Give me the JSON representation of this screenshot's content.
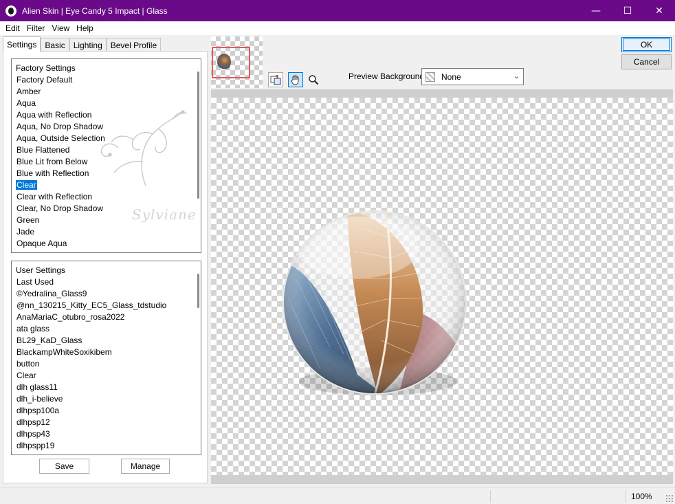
{
  "window": {
    "title": "Alien Skin | Eye Candy 5 Impact | Glass",
    "controls": {
      "minimize": "—",
      "maximize": "☐",
      "close": "✕"
    }
  },
  "menu": {
    "items": [
      {
        "label": "Edit"
      },
      {
        "label": "Filter"
      },
      {
        "label": "View"
      },
      {
        "label": "Help"
      }
    ]
  },
  "tabs": [
    {
      "label": "Settings",
      "active": true
    },
    {
      "label": "Basic"
    },
    {
      "label": "Lighting"
    },
    {
      "label": "Bevel Profile"
    }
  ],
  "factory_settings": {
    "header": "Factory Settings",
    "items": [
      "Factory Default",
      "Amber",
      "Aqua",
      "Aqua with Reflection",
      "Aqua, No Drop Shadow",
      "Aqua, Outside Selection",
      "Blue Flattened",
      "Blue Lit from Below",
      "Blue with Reflection",
      "Clear",
      "Clear with Reflection",
      "Clear, No Drop Shadow",
      "Green",
      "Jade",
      "Opaque Aqua"
    ],
    "selected": "Clear"
  },
  "user_settings": {
    "header": "User Settings",
    "items": [
      "Last Used",
      "©Yedralina_Glass9",
      "@nn_130215_Kitty_EC5_Glass_tdstudio",
      "AnaMariaC_otubro_rosa2022",
      "ata glass",
      "BL29_KaD_Glass",
      "BlackampWhiteSoxikibem",
      "button",
      "Clear",
      "dlh glass11",
      "dlh_i-believe",
      "dlhpsp100a",
      "dlhpsp12",
      "dlhpsp43",
      "dlhpspp19"
    ]
  },
  "watermark": "Sylviane",
  "buttons": {
    "save": "Save",
    "manage": "Manage",
    "ok": "OK",
    "cancel": "Cancel"
  },
  "toolbar": {
    "navigator_icon": "navigator-icon",
    "hand_icon": "hand-icon",
    "zoom_icon": "zoom-icon"
  },
  "preview_background": {
    "label": "Preview Background:",
    "value": "None"
  },
  "status": {
    "zoom": "100%"
  },
  "colors": {
    "titlebar": "#6a0a88",
    "selection": "#0078d7",
    "thumb_frame": "#e05a5a"
  }
}
